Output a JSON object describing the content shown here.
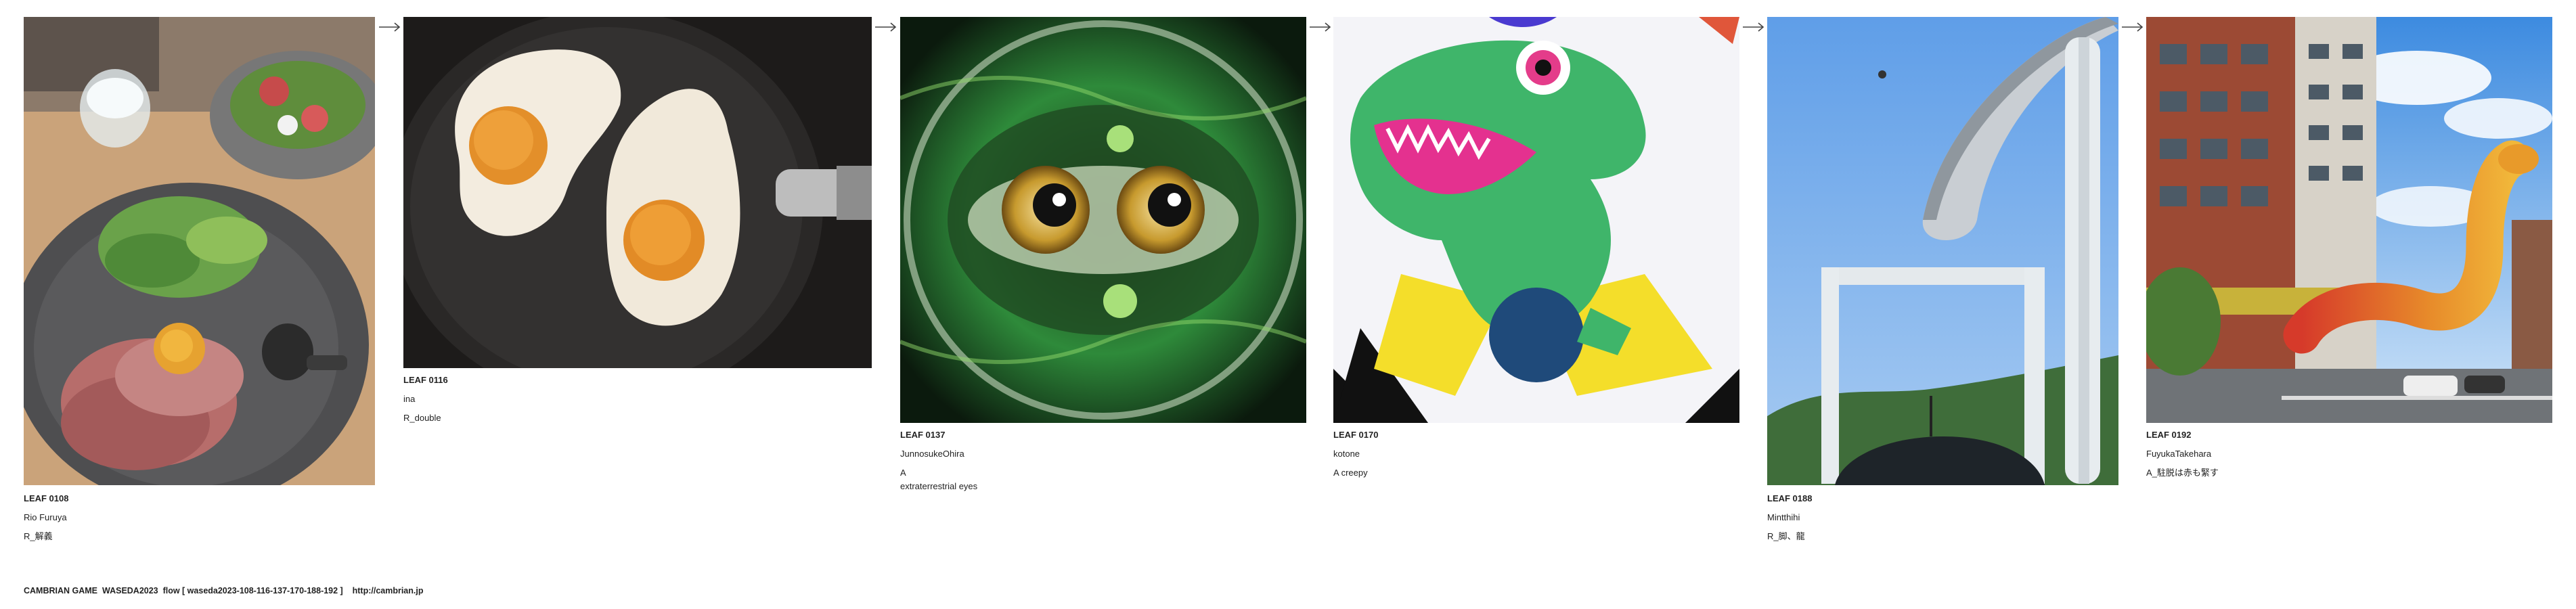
{
  "leaves": [
    {
      "id": "LEAF 0108",
      "author": "Rio Furuya",
      "title": "R_解義",
      "image": "rice-bowl-salad-photo"
    },
    {
      "id": "LEAF 0116",
      "author": "ina",
      "title": "R_double",
      "image": "fried-eggs-pan-photo"
    },
    {
      "id": "LEAF 0137",
      "author": "JunnosukeOhira",
      "title": "A\nextraterrestrial eyes",
      "image": "green-alien-eyes-art"
    },
    {
      "id": "LEAF 0170",
      "author": "kotone",
      "title": "A creepy",
      "image": "green-dinosaur-art"
    },
    {
      "id": "LEAF 0188",
      "author": "Mintthihi",
      "title": "R_脚、龍",
      "image": "elevated-highway-photo"
    },
    {
      "id": "LEAF 0192",
      "author": "FuyukaTakehara",
      "title": "A_駐脱は赤も緊す",
      "image": "street-serpent-photo"
    }
  ],
  "footer": {
    "text": "CAMBRIAN GAME  WASEDA2023  flow [ waseda2023-108-116-137-170-188-192 ]    http://cambrian.jp"
  },
  "colors": {
    "background": "#ffffff",
    "text": "#222222",
    "arrow": "#444444"
  }
}
